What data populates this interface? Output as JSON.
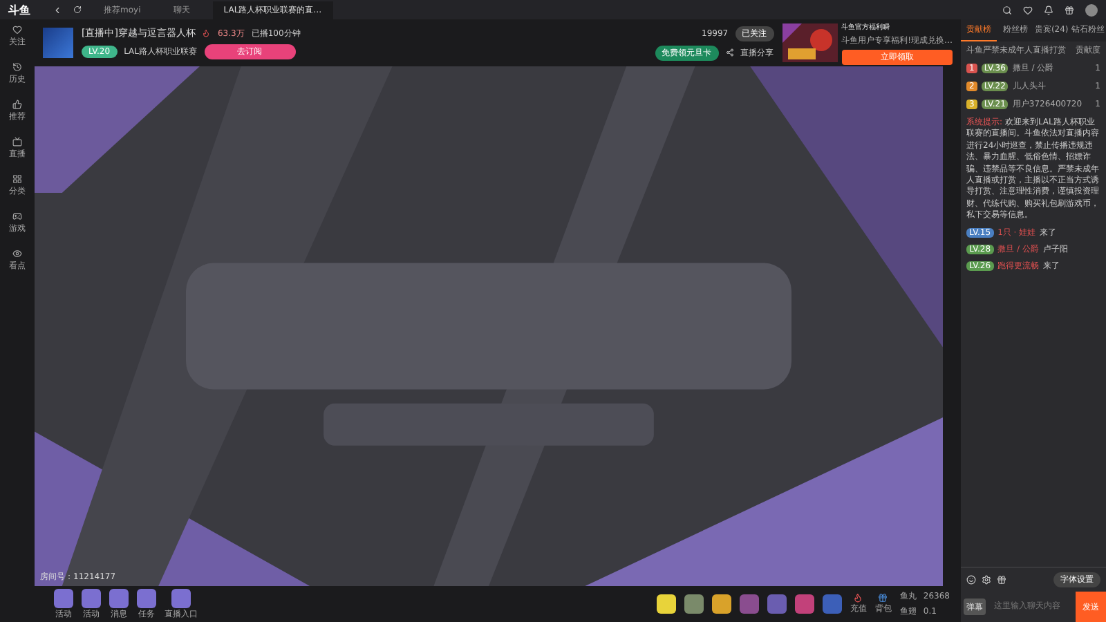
{
  "browser": {
    "logo": "斗鱼",
    "tabs": [
      {
        "label": "推荐moyi",
        "selected": false
      },
      {
        "label": "聊天",
        "selected": false
      },
      {
        "label": "LAL路人杯职业联赛的直…",
        "selected": true
      }
    ]
  },
  "sidebar": {
    "items": [
      {
        "label": "关注"
      },
      {
        "label": "历史"
      },
      {
        "label": "推荐"
      },
      {
        "label": "直播"
      },
      {
        "label": "分类"
      },
      {
        "label": "游戏"
      },
      {
        "label": "看点"
      }
    ]
  },
  "room": {
    "title": "[直播中]穿越与逗言器人杯",
    "heat": "63.3万",
    "duration": "已播100分钟",
    "level": "LV.20",
    "category": "LAL路人杯职业联赛",
    "subscribe": "去订阅",
    "followers": "19997",
    "follow": "已关注",
    "free_card": "免费领元旦卡",
    "share": "直播分享",
    "room_id": "房间号：11214177"
  },
  "promo": {
    "title": "斗鱼官方福利瞬",
    "subtitle": "斗鱼用户专享福利!现成兑换…",
    "button": "立即领取"
  },
  "gift_bar": {
    "left": [
      "活动",
      "活动",
      "消息",
      "任务",
      "直播入口"
    ],
    "recharge": "充值",
    "backpack": "背包",
    "fish_ball_label": "鱼丸",
    "fish_ball": "26368",
    "fish_fin_label": "鱼翅",
    "fish_fin": "0.1"
  },
  "chat": {
    "tabs": [
      {
        "label": "贡献榜",
        "selected": true
      },
      {
        "label": "粉丝榜",
        "selected": false
      },
      {
        "label": "贵宾(24)",
        "selected": false
      },
      {
        "label": "钻石粉丝",
        "selected": false
      }
    ],
    "notice": "斗鱼严禁未成年人直播打赏",
    "score_label": "贡献度",
    "ranks": [
      {
        "rank": "1",
        "badge": "LV.36",
        "name": "撒旦 / 公爵",
        "score": "1",
        "color": "#d9534f"
      },
      {
        "rank": "2",
        "badge": "LV.22",
        "name": "儿人头斗",
        "score": "1",
        "color": "#e38a2a"
      },
      {
        "rank": "3",
        "badge": "LV.21",
        "name": "用户3726400720",
        "score": "1",
        "color": "#d9b12a"
      }
    ],
    "system_label": "系统提示:",
    "system_text": "欢迎来到LAL路人杯职业联赛的直播间。斗鱼依法对直播内容进行24小时巡查，禁止传播违规违法、暴力血腥、低俗色情、招嫖诈骗、违禁品等不良信息。严禁未成年人直播或打赏，主播以不正当方式诱导打赏、注意理性消费，谨慎投资理财、代练代购、购买礼包刷游戏币，私下交易等信息。",
    "messages": [
      {
        "badge": "LV.15",
        "name": "1只 · 娃娃",
        "text": "来了",
        "color": "#4a7fc1"
      },
      {
        "badge": "LV.28",
        "name": "撒旦 / 公爵",
        "text": "卢子阳",
        "color": "#5b9b4f"
      },
      {
        "badge": "LV.26",
        "name": "跑得更流畅",
        "text": "来了",
        "color": "#5b9b4f"
      }
    ],
    "barrage": "弹幕",
    "input_placeholder": "这里输入聊天内容",
    "send": "发送",
    "style_label": "字体设置"
  }
}
